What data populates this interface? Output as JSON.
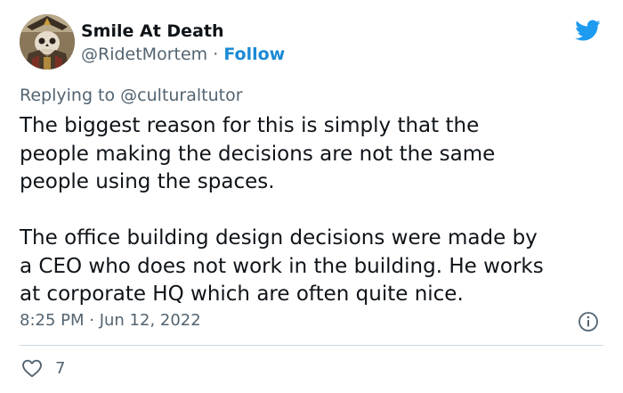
{
  "user": {
    "display_name": "Smile At Death",
    "handle": "@RidetMortem",
    "separator": "·",
    "follow_label": "Follow"
  },
  "reply": {
    "prefix": "Replying to",
    "mention": "@culturaltutor"
  },
  "tweet": {
    "paragraph_1": "The biggest reason for this is simply that the\npeople making the decisions are not the same\npeople using the spaces.",
    "paragraph_2": "The office building design decisions were made by\na CEO who does not work in the building. He works\nat corporate HQ which are often quite nice.",
    "timestamp": "8:25 PM · Jun 12, 2022"
  },
  "actions": {
    "like_count": "7"
  },
  "icons": {
    "brand": "twitter-bird-icon",
    "info": "info-icon",
    "like": "heart-icon"
  },
  "colors": {
    "twitter_blue": "#1d9bf0",
    "follow_link": "#1b8ad6",
    "secondary_text": "#536471",
    "primary_text": "#0f1419",
    "divider": "#cfd9de"
  }
}
